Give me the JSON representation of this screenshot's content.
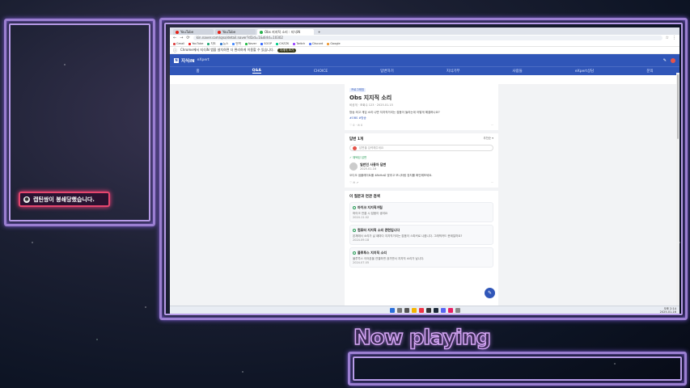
{
  "overlay": {
    "alert_text": "캡틴쌍이 봉쇄당했습니다.",
    "now_playing": "Now playing"
  },
  "browser": {
    "tabs": [
      {
        "label": "YouTube",
        "active": false,
        "color": "#e62117"
      },
      {
        "label": "YouTube",
        "active": false,
        "color": "#e62117"
      },
      {
        "label": "Obs 지지직 소리 : 지식iN",
        "active": true,
        "color": "#2ab24f"
      },
      {
        "label": "+",
        "active": false,
        "color": "#999999"
      }
    ],
    "url": "kin.naver.com/qna/detail.naver?d1id=1&dirId=10302",
    "bookmarks": [
      "Gmail",
      "YouTube",
      "지도",
      "뉴스",
      "번역",
      "Naver",
      "SOOP",
      "CHZZK",
      "Twitch",
      "Discord",
      "Google"
    ],
    "notice_text": "Chrome에서 지식iN 앱을 설치하면 더 편리하게 이용할 수 있습니다.",
    "notice_button": "자세히 보기"
  },
  "kin": {
    "logo": "지식iN",
    "logo_sub": "eXpert",
    "nav": [
      "홈",
      "Q&A",
      "CHOICE",
      "답변하기",
      "지식기부",
      "사람들",
      "eXpert상담",
      "문의"
    ],
    "active_nav": "Q&A",
    "question": {
      "tag": "프로그래밍",
      "title": "Obs 지지직 소리",
      "meta": "비공개 · 조회수 123 · 2025.01.15",
      "body": "방송 켜고 게임 소리 나면 지지직거리는 잡음이 들리는데 어떻게 해결하나요?",
      "link": "#OBS #방송",
      "likes": "0",
      "comments": "0"
    },
    "answers_header": "답변 1개",
    "sort_label": "추천순 ▾",
    "answer_input_placeholder": "답변을 입력해주세요",
    "answer": {
      "badge": "채택된 답변",
      "author": "일반인 사용자 답변",
      "date": "2025.01.16",
      "body": "오디오 샘플레이트를 48kHz로 맞추고 모니터링 장치를 확인해보세요."
    },
    "related_title": "이 질문과 연관 검색",
    "related": [
      {
        "title": "마이크 지지직거림",
        "desc": "마이크 연결 시 잡음이 생겨요",
        "date": "2024.11.02"
      },
      {
        "title": "컴퓨터 지지직 소리 관련입니다",
        "desc": "본체에서 소리가 날 때마다 지지직거리는 잡음이 스피커로 나옵니다. 그래픽카드 문제일까요?",
        "date": "2024.09.18"
      },
      {
        "title": "블루투스 지지직 소리",
        "desc": "블루투스 이어폰을 연결하면 끊기면서 지지직 소리가 납니다.",
        "date": "2024.07.05"
      }
    ]
  },
  "taskbar": {
    "time": "오후 2:14",
    "date": "2025-01-16"
  }
}
